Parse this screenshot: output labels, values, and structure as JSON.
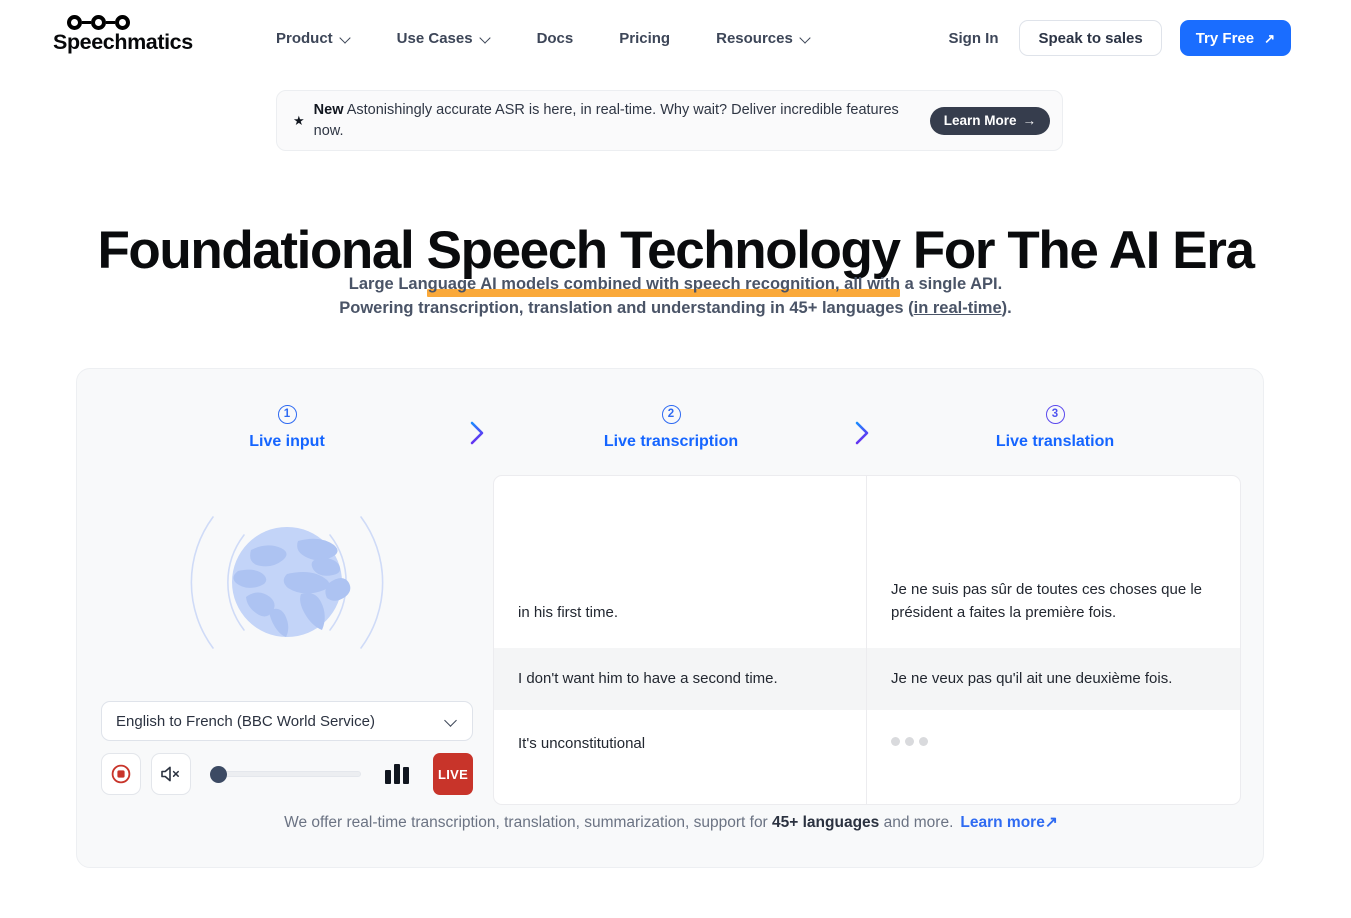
{
  "header": {
    "logo_text": "Speechmatics",
    "logo_icon": "speechmatics-logo-icon",
    "nav": [
      {
        "label": "Product",
        "has_dropdown": true
      },
      {
        "label": "Use Cases",
        "has_dropdown": true
      },
      {
        "label": "Docs",
        "has_dropdown": false
      },
      {
        "label": "Pricing",
        "has_dropdown": false
      },
      {
        "label": "Resources",
        "has_dropdown": true
      }
    ],
    "sign_in": "Sign In",
    "speak_to_sales": "Speak to sales",
    "try_free": "Try Free",
    "try_free_arrow": "↗"
  },
  "banner": {
    "star_icon": "★",
    "tag": "New",
    "text": " Astonishingly accurate ASR is here, in real-time. Why wait? Deliver incredible features now.",
    "cta": "Learn More",
    "cta_arrow": "→"
  },
  "hero": {
    "title_pre": "Foundational ",
    "title_highlight": "Speech Technology",
    "title_post": " For The AI Era",
    "highlight_color": "#faa93a",
    "sub_line1": "Large Language AI models combined with speech recognition, all with a single API.",
    "sub_line2_pre": "Powering transcription, translation and understanding in 45+ languages (",
    "sub_line2_link": "in real-time",
    "sub_line2_post": ")."
  },
  "demo": {
    "steps": [
      {
        "number": "1",
        "label": "Live input"
      },
      {
        "number": "2",
        "label": "Live transcription"
      },
      {
        "number": "3",
        "label": "Live translation"
      }
    ],
    "chevron_icon": "chevron-right-icon",
    "globe_icon": "globe-with-soundwaves-icon",
    "language_select": {
      "value": "English to French (BBC World Service)",
      "chevron_icon": "chevron-down-icon"
    },
    "controls": {
      "stop_icon": "stop-recording-icon",
      "mute_icon": "speaker-mute-icon",
      "volume_value": "0",
      "equalizer_icon": "audio-levels-icon",
      "live_label": "LIVE"
    },
    "rows": [
      {
        "transcription": "in his first time.",
        "translation": "Je ne suis pas sûr de toutes ces choses que le président a faites la première fois.",
        "translation_pending": false
      },
      {
        "transcription": "I don't want him to have a second time.",
        "translation": "Je ne veux pas qu'il ait une deuxième fois.",
        "translation_pending": false
      },
      {
        "transcription": "It's unconstitutional",
        "translation": "",
        "translation_pending": true
      }
    ],
    "footer_pre": "We offer real-time transcription, translation, summarization, support for ",
    "footer_bold": "45+ languages",
    "footer_post": " and more.",
    "footer_link": "Learn more",
    "footer_link_arrow": "↗"
  },
  "colors": {
    "primary_blue": "#1a6dff",
    "step_blue": "#1565ff",
    "accent_orange": "#faa93a",
    "live_red": "#c8342a",
    "text_dark": "#11161f"
  }
}
